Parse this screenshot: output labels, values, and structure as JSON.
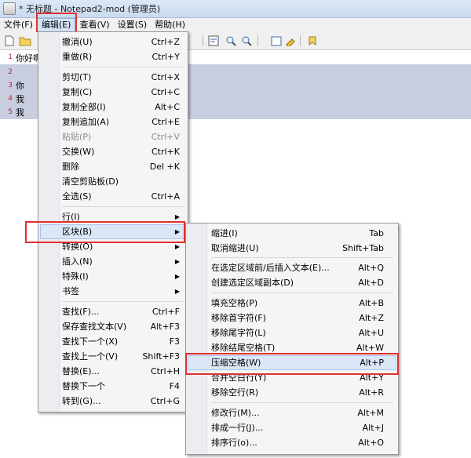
{
  "window": {
    "title": "* 无标题 - Notepad2-mod (管理员)"
  },
  "menubar": [
    {
      "label": "文件(F)"
    },
    {
      "label": "编辑(E)"
    },
    {
      "label": "查看(V)"
    },
    {
      "label": "设置(S)"
    },
    {
      "label": "帮助(H)"
    }
  ],
  "toolbar_icons": [
    "new-file-icon",
    "open-folder-icon",
    "find-replace-icon",
    "word-wrap-icon",
    "zoom-in-icon",
    "zoom-out-icon",
    "select-all-icon",
    "settings-icon",
    "favorites-icon"
  ],
  "editor": {
    "line_numbers": [
      "1",
      "2",
      "3",
      "4",
      "5"
    ],
    "lines": [
      "你好啊",
      "",
      "你",
      "我",
      "我"
    ]
  },
  "edit_menu": {
    "items": [
      {
        "label": "撤消(U)",
        "shortcut": "Ctrl+Z"
      },
      {
        "label": "重做(R)",
        "shortcut": "Ctrl+Y"
      },
      {
        "label": "剪切(T)",
        "shortcut": "Ctrl+X"
      },
      {
        "label": "复制(C)",
        "shortcut": "Ctrl+C"
      },
      {
        "label": "复制全部(I)",
        "shortcut": "Alt+C"
      },
      {
        "label": "复制追加(A)",
        "shortcut": "Ctrl+E"
      },
      {
        "label": "粘贴(P)",
        "shortcut": "Ctrl+V"
      },
      {
        "label": "交换(W)",
        "shortcut": "Ctrl+K"
      },
      {
        "label": "删除",
        "shortcut": "Del +K"
      },
      {
        "label": "清空剪贴板(D)",
        "shortcut": ""
      },
      {
        "label": "全选(S)",
        "shortcut": "Ctrl+A"
      },
      {
        "label": "行(I)",
        "shortcut": ""
      },
      {
        "label": "区块(B)",
        "shortcut": ""
      },
      {
        "label": "转换(O)",
        "shortcut": ""
      },
      {
        "label": "插入(N)",
        "shortcut": ""
      },
      {
        "label": "特殊(I)",
        "shortcut": ""
      },
      {
        "label": "书签",
        "shortcut": ""
      },
      {
        "label": "查找(F)...",
        "shortcut": "Ctrl+F"
      },
      {
        "label": "保存查找文本(V)",
        "shortcut": "Alt+F3"
      },
      {
        "label": "查找下一个(X)",
        "shortcut": "F3"
      },
      {
        "label": "查找上一个(V)",
        "shortcut": "Shift+F3"
      },
      {
        "label": "替换(E)...",
        "shortcut": "Ctrl+H"
      },
      {
        "label": "替换下一个",
        "shortcut": "F4"
      },
      {
        "label": "转到(G)...",
        "shortcut": "Ctrl+G"
      }
    ]
  },
  "block_submenu": {
    "items": [
      {
        "label": "缩进(I)",
        "shortcut": "Tab"
      },
      {
        "label": "取消缩进(U)",
        "shortcut": "Shift+Tab"
      },
      {
        "label": "在选定区域前/后插入文本(E)...",
        "shortcut": "Alt+Q"
      },
      {
        "label": "创建选定区域副本(D)",
        "shortcut": "Alt+D"
      },
      {
        "label": "填充空格(P)",
        "shortcut": "Alt+B"
      },
      {
        "label": "移除首字符(F)",
        "shortcut": "Alt+Z"
      },
      {
        "label": "移除尾字符(L)",
        "shortcut": "Alt+U"
      },
      {
        "label": "移除结尾空格(T)",
        "shortcut": "Alt+W"
      },
      {
        "label": "压缩空格(W)",
        "shortcut": "Alt+P"
      },
      {
        "label": "合并空白行(Y)",
        "shortcut": "Alt+Y"
      },
      {
        "label": "移除空行(R)",
        "shortcut": "Alt+R"
      },
      {
        "label": "修改行(M)...",
        "shortcut": "Alt+M"
      },
      {
        "label": "排成一行(J)...",
        "shortcut": "Alt+J"
      },
      {
        "label": "排序行(o)...",
        "shortcut": "Alt+O"
      }
    ]
  }
}
